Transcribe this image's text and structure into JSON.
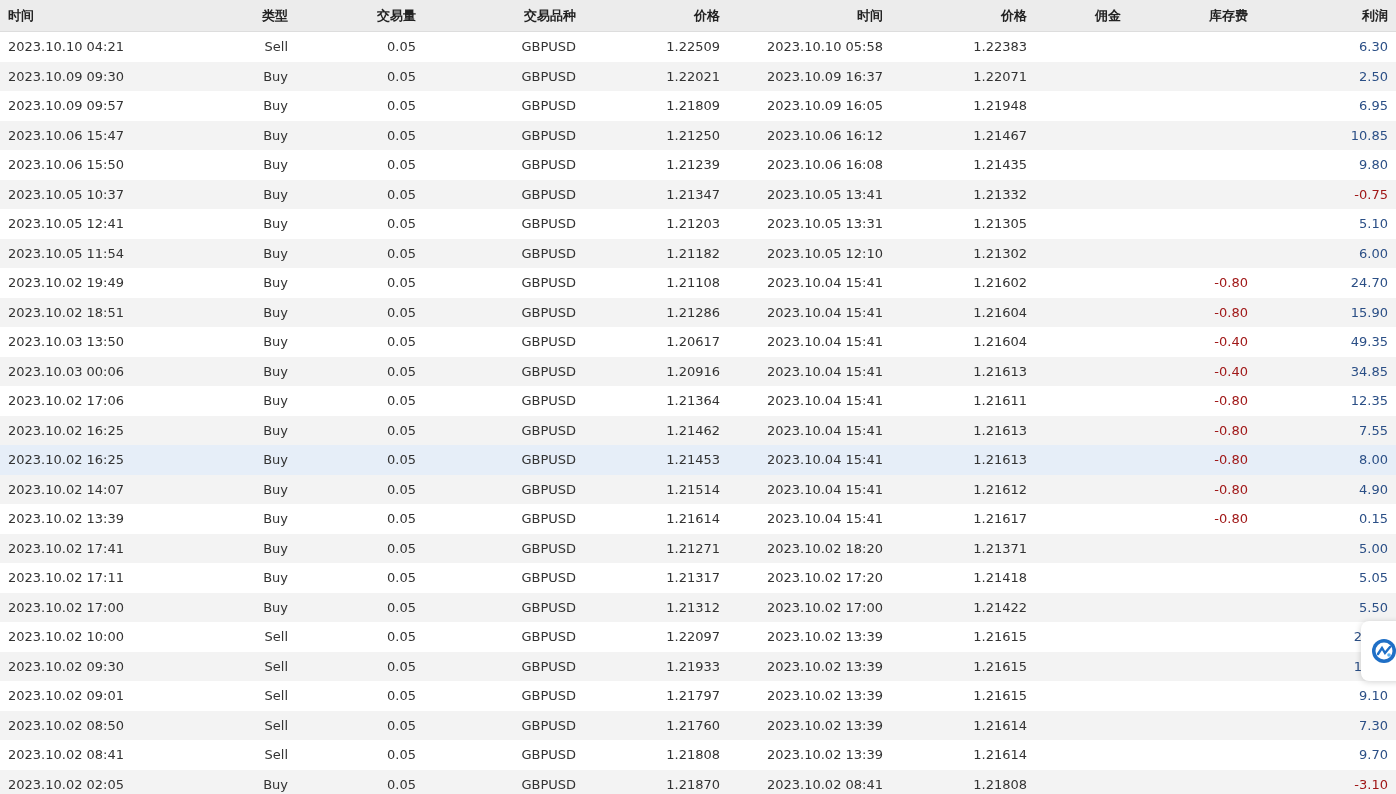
{
  "columns": [
    "时间",
    "类型",
    "交易量",
    "交易品种",
    "价格",
    "时间",
    "价格",
    "佣金",
    "库存费",
    "利润"
  ],
  "rows": [
    {
      "open_time": "2023.10.10 04:21",
      "type": "Sell",
      "volume": "0.05",
      "symbol": "GBPUSD",
      "open_price": "1.22509",
      "close_time": "2023.10.10 05:58",
      "close_price": "1.22383",
      "profit": "6.30",
      "loss": false,
      "selected": false
    },
    {
      "open_time": "2023.10.09 09:30",
      "type": "Buy",
      "volume": "0.05",
      "symbol": "GBPUSD",
      "open_price": "1.22021",
      "close_time": "2023.10.09 16:37",
      "close_price": "1.22071",
      "profit": "2.50",
      "loss": false,
      "selected": false
    },
    {
      "open_time": "2023.10.09 09:57",
      "type": "Buy",
      "volume": "0.05",
      "symbol": "GBPUSD",
      "open_price": "1.21809",
      "close_time": "2023.10.09 16:05",
      "close_price": "1.21948",
      "profit": "6.95",
      "loss": false,
      "selected": false
    },
    {
      "open_time": "2023.10.06 15:47",
      "type": "Buy",
      "volume": "0.05",
      "symbol": "GBPUSD",
      "open_price": "1.21250",
      "close_time": "2023.10.06 16:12",
      "close_price": "1.21467",
      "profit": "10.85",
      "loss": false,
      "selected": false
    },
    {
      "open_time": "2023.10.06 15:50",
      "type": "Buy",
      "volume": "0.05",
      "symbol": "GBPUSD",
      "open_price": "1.21239",
      "close_time": "2023.10.06 16:08",
      "close_price": "1.21435",
      "profit": "9.80",
      "loss": false,
      "selected": false
    },
    {
      "open_time": "2023.10.05 10:37",
      "type": "Buy",
      "volume": "0.05",
      "symbol": "GBPUSD",
      "open_price": "1.21347",
      "close_time": "2023.10.05 13:41",
      "close_price": "1.21332",
      "profit": "-0.75",
      "loss": true,
      "selected": false
    },
    {
      "open_time": "2023.10.05 12:41",
      "type": "Buy",
      "volume": "0.05",
      "symbol": "GBPUSD",
      "open_price": "1.21203",
      "close_time": "2023.10.05 13:31",
      "close_price": "1.21305",
      "profit": "5.10",
      "loss": false,
      "selected": false
    },
    {
      "open_time": "2023.10.05 11:54",
      "type": "Buy",
      "volume": "0.05",
      "symbol": "GBPUSD",
      "open_price": "1.21182",
      "close_time": "2023.10.05 12:10",
      "close_price": "1.21302",
      "profit": "6.00",
      "loss": false,
      "selected": false
    },
    {
      "open_time": "2023.10.02 19:49",
      "type": "Buy",
      "volume": "0.05",
      "symbol": "GBPUSD",
      "open_price": "1.21108",
      "close_time": "2023.10.04 15:41",
      "close_price": "1.21602",
      "swap": "-0.80",
      "profit": "24.70",
      "loss": false,
      "selected": false
    },
    {
      "open_time": "2023.10.02 18:51",
      "type": "Buy",
      "volume": "0.05",
      "symbol": "GBPUSD",
      "open_price": "1.21286",
      "close_time": "2023.10.04 15:41",
      "close_price": "1.21604",
      "swap": "-0.80",
      "profit": "15.90",
      "loss": false,
      "selected": false
    },
    {
      "open_time": "2023.10.03 13:50",
      "type": "Buy",
      "volume": "0.05",
      "symbol": "GBPUSD",
      "open_price": "1.20617",
      "close_time": "2023.10.04 15:41",
      "close_price": "1.21604",
      "swap": "-0.40",
      "profit": "49.35",
      "loss": false,
      "selected": false
    },
    {
      "open_time": "2023.10.03 00:06",
      "type": "Buy",
      "volume": "0.05",
      "symbol": "GBPUSD",
      "open_price": "1.20916",
      "close_time": "2023.10.04 15:41",
      "close_price": "1.21613",
      "swap": "-0.40",
      "profit": "34.85",
      "loss": false,
      "selected": false
    },
    {
      "open_time": "2023.10.02 17:06",
      "type": "Buy",
      "volume": "0.05",
      "symbol": "GBPUSD",
      "open_price": "1.21364",
      "close_time": "2023.10.04 15:41",
      "close_price": "1.21611",
      "swap": "-0.80",
      "profit": "12.35",
      "loss": false,
      "selected": false
    },
    {
      "open_time": "2023.10.02 16:25",
      "type": "Buy",
      "volume": "0.05",
      "symbol": "GBPUSD",
      "open_price": "1.21462",
      "close_time": "2023.10.04 15:41",
      "close_price": "1.21613",
      "swap": "-0.80",
      "profit": "7.55",
      "loss": false,
      "selected": false
    },
    {
      "open_time": "2023.10.02 16:25",
      "type": "Buy",
      "volume": "0.05",
      "symbol": "GBPUSD",
      "open_price": "1.21453",
      "close_time": "2023.10.04 15:41",
      "close_price": "1.21613",
      "swap": "-0.80",
      "profit": "8.00",
      "loss": false,
      "selected": true
    },
    {
      "open_time": "2023.10.02 14:07",
      "type": "Buy",
      "volume": "0.05",
      "symbol": "GBPUSD",
      "open_price": "1.21514",
      "close_time": "2023.10.04 15:41",
      "close_price": "1.21612",
      "swap": "-0.80",
      "profit": "4.90",
      "loss": false,
      "selected": false
    },
    {
      "open_time": "2023.10.02 13:39",
      "type": "Buy",
      "volume": "0.05",
      "symbol": "GBPUSD",
      "open_price": "1.21614",
      "close_time": "2023.10.04 15:41",
      "close_price": "1.21617",
      "swap": "-0.80",
      "profit": "0.15",
      "loss": false,
      "selected": false
    },
    {
      "open_time": "2023.10.02 17:41",
      "type": "Buy",
      "volume": "0.05",
      "symbol": "GBPUSD",
      "open_price": "1.21271",
      "close_time": "2023.10.02 18:20",
      "close_price": "1.21371",
      "profit": "5.00",
      "loss": false,
      "selected": false
    },
    {
      "open_time": "2023.10.02 17:11",
      "type": "Buy",
      "volume": "0.05",
      "symbol": "GBPUSD",
      "open_price": "1.21317",
      "close_time": "2023.10.02 17:20",
      "close_price": "1.21418",
      "profit": "5.05",
      "loss": false,
      "selected": false
    },
    {
      "open_time": "2023.10.02 17:00",
      "type": "Buy",
      "volume": "0.05",
      "symbol": "GBPUSD",
      "open_price": "1.21312",
      "close_time": "2023.10.02 17:00",
      "close_price": "1.21422",
      "profit": "5.50",
      "loss": false,
      "selected": false
    },
    {
      "open_time": "2023.10.02 10:00",
      "type": "Sell",
      "volume": "0.05",
      "symbol": "GBPUSD",
      "open_price": "1.22097",
      "close_time": "2023.10.02 13:39",
      "close_price": "1.21615",
      "profit": "2",
      "profit_covered": true,
      "loss": false,
      "selected": false
    },
    {
      "open_time": "2023.10.02 09:30",
      "type": "Sell",
      "volume": "0.05",
      "symbol": "GBPUSD",
      "open_price": "1.21933",
      "close_time": "2023.10.02 13:39",
      "close_price": "1.21615",
      "profit": "1",
      "profit_covered": true,
      "loss": false,
      "selected": false
    },
    {
      "open_time": "2023.10.02 09:01",
      "type": "Sell",
      "volume": "0.05",
      "symbol": "GBPUSD",
      "open_price": "1.21797",
      "close_time": "2023.10.02 13:39",
      "close_price": "1.21615",
      "profit": "9.10",
      "loss": false,
      "selected": false
    },
    {
      "open_time": "2023.10.02 08:50",
      "type": "Sell",
      "volume": "0.05",
      "symbol": "GBPUSD",
      "open_price": "1.21760",
      "close_time": "2023.10.02 13:39",
      "close_price": "1.21614",
      "profit": "7.30",
      "loss": false,
      "selected": false
    },
    {
      "open_time": "2023.10.02 08:41",
      "type": "Sell",
      "volume": "0.05",
      "symbol": "GBPUSD",
      "open_price": "1.21808",
      "close_time": "2023.10.02 13:39",
      "close_price": "1.21614",
      "profit": "9.70",
      "loss": false,
      "selected": false
    },
    {
      "open_time": "2023.10.02 02:05",
      "type": "Buy",
      "volume": "0.05",
      "symbol": "GBPUSD",
      "open_price": "1.21870",
      "close_time": "2023.10.02 08:41",
      "close_price": "1.21808",
      "profit": "-3.10",
      "loss": true,
      "selected": false
    }
  ]
}
